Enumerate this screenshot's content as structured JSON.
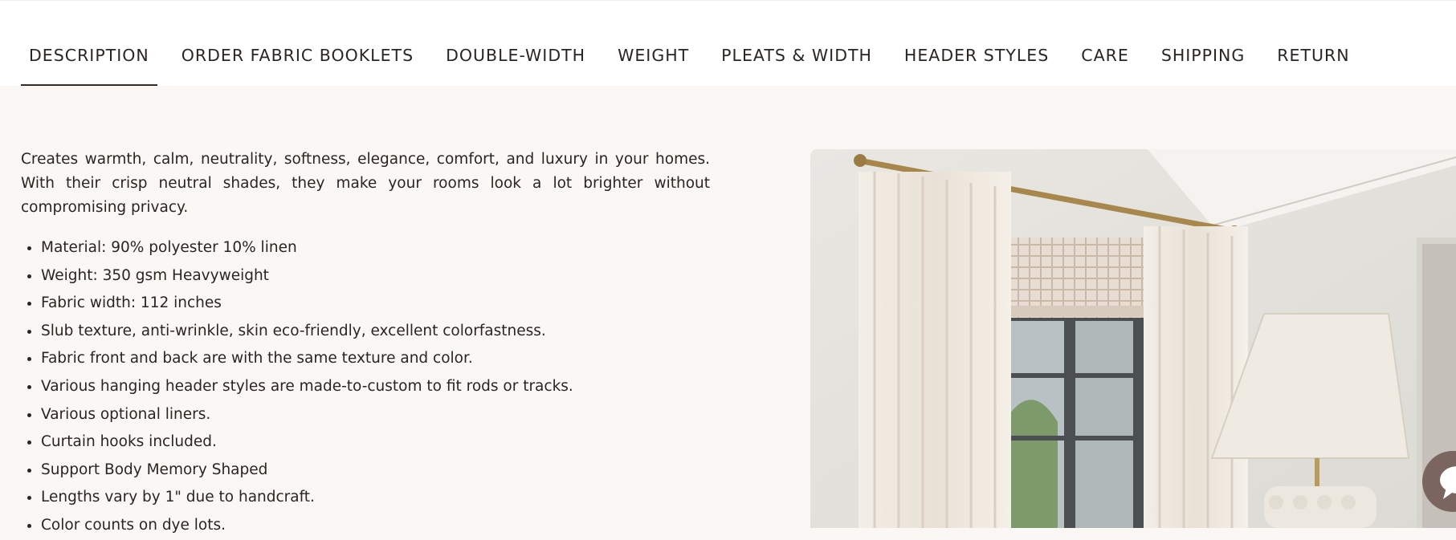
{
  "tabs": [
    {
      "label": "DESCRIPTION",
      "active": true
    },
    {
      "label": "ORDER FABRIC BOOKLETS"
    },
    {
      "label": "DOUBLE-WIDTH"
    },
    {
      "label": "WEIGHT"
    },
    {
      "label": "PLEATS & WIDTH"
    },
    {
      "label": "HEADER STYLES"
    },
    {
      "label": "CARE"
    },
    {
      "label": "SHIPPING"
    },
    {
      "label": "RETURN"
    }
  ],
  "description": {
    "intro": "Creates warmth, calm, neutrality, softness, elegance, comfort, and luxury in your homes. With their crisp neutral shades, they make your rooms look a lot brighter without compromising privacy.",
    "bullets": [
      "Material: 90% polyester 10% linen",
      "Weight: 350 gsm Heavyweight",
      "Fabric width: 112 inches",
      "Slub texture, anti-wrinkle, skin eco-friendly, excellent colorfastness.",
      "Fabric front and back are with the same texture and color.",
      "Various hanging header styles are made-to-custom to fit rods or tracks.",
      "Various optional liners.",
      "Curtain hooks included.",
      "Support Body Memory Shaped",
      "Lengths vary by 1\" due to handcraft.",
      "Color counts on dye lots."
    ]
  },
  "colors": {
    "background": "#faf7f4",
    "text": "#2b2522",
    "active_underline": "#3a2a22",
    "chat_button": "#7a6560"
  },
  "icons": {
    "chat": "chat-bubble-icon"
  }
}
